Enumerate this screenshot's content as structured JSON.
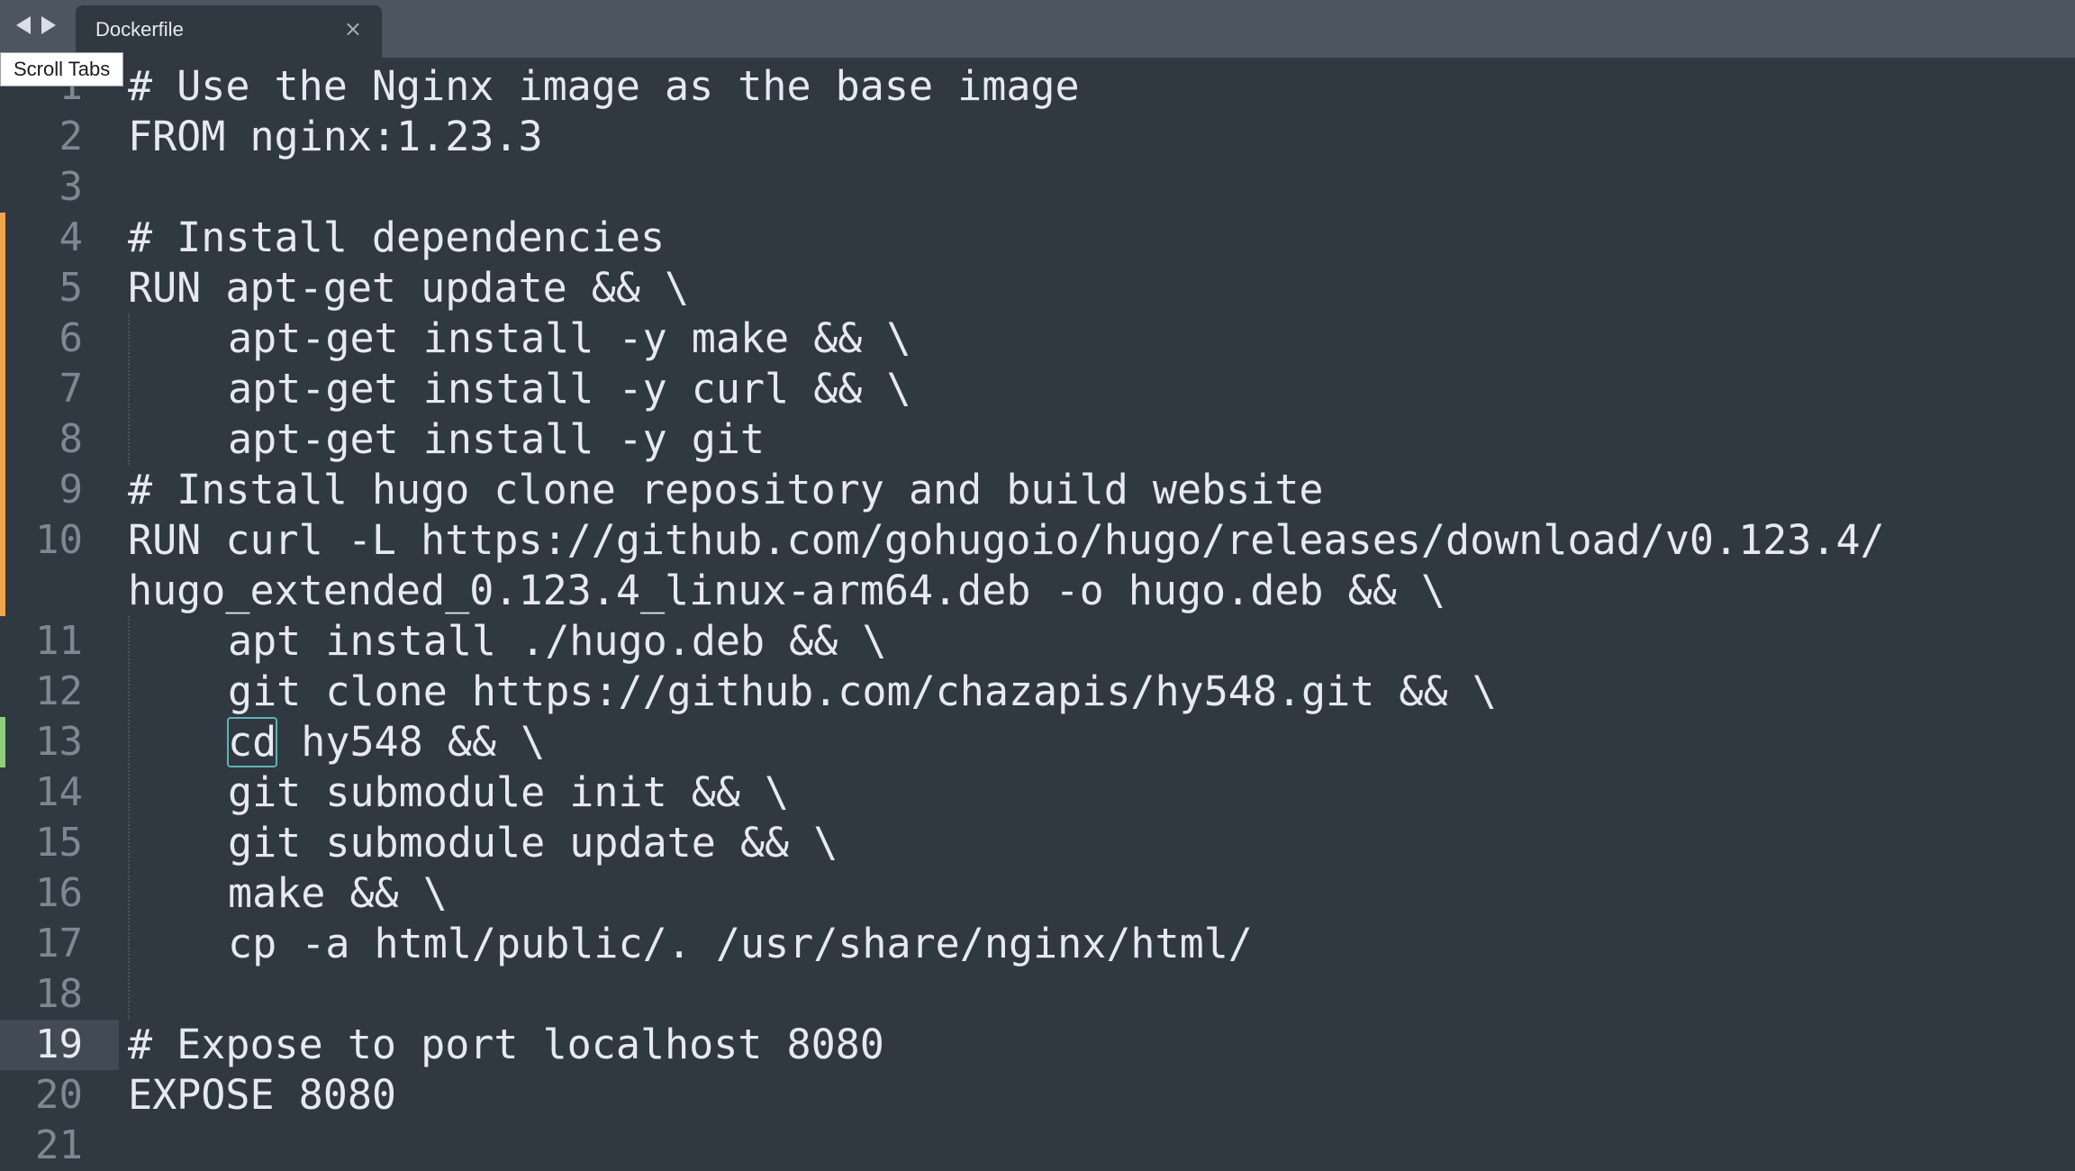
{
  "tabbar": {
    "tab_title": "Dockerfile",
    "close_glyph": "×",
    "tooltip": "Scroll Tabs",
    "nav_back_icon": "triangle-left",
    "nav_forward_icon": "triangle-right"
  },
  "editor": {
    "current_line": 19,
    "lines": [
      {
        "num": "1",
        "text": "# Use the Nginx image as the base image"
      },
      {
        "num": "2",
        "text": "FROM nginx:1.23.3"
      },
      {
        "num": "3",
        "text": ""
      },
      {
        "num": "4",
        "text": "# Install dependencies"
      },
      {
        "num": "5",
        "text": "RUN apt-get update && \\"
      },
      {
        "num": "6",
        "text": "apt-get install -y make && \\"
      },
      {
        "num": "7",
        "text": "apt-get install -y curl && \\"
      },
      {
        "num": "8",
        "text": "apt-get install -y git"
      },
      {
        "num": "9",
        "text": "# Install hugo clone repository and build website"
      },
      {
        "num": "10",
        "text": "RUN curl -L https://github.com/gohugoio/hugo/releases/download/v0.123.4/"
      },
      {
        "num": "",
        "text": "hugo_extended_0.123.4_linux-arm64.deb -o hugo.deb && \\"
      },
      {
        "num": "11",
        "text": "apt install ./hugo.deb && \\"
      },
      {
        "num": "12",
        "text": "git clone https://github.com/chazapis/hy548.git && \\"
      },
      {
        "num": "13",
        "text": "cd hy548 && \\"
      },
      {
        "num": "14",
        "text": "git submodule init && \\"
      },
      {
        "num": "15",
        "text": "git submodule update && \\"
      },
      {
        "num": "16",
        "text": "make && \\"
      },
      {
        "num": "17",
        "text": "cp -a html/public/. /usr/share/nginx/html/"
      },
      {
        "num": "18",
        "text": ""
      },
      {
        "num": "19",
        "text": "# Expose to port localhost 8080"
      },
      {
        "num": "20",
        "text": "EXPOSE 8080"
      },
      {
        "num": "21",
        "text": ""
      }
    ]
  },
  "colors": {
    "background": "#303841",
    "tabbar": "#4d5660",
    "diff_modified": "#f1a54c",
    "diff_added": "#8fcf7b",
    "bracket_match": "#5fb3b3"
  }
}
